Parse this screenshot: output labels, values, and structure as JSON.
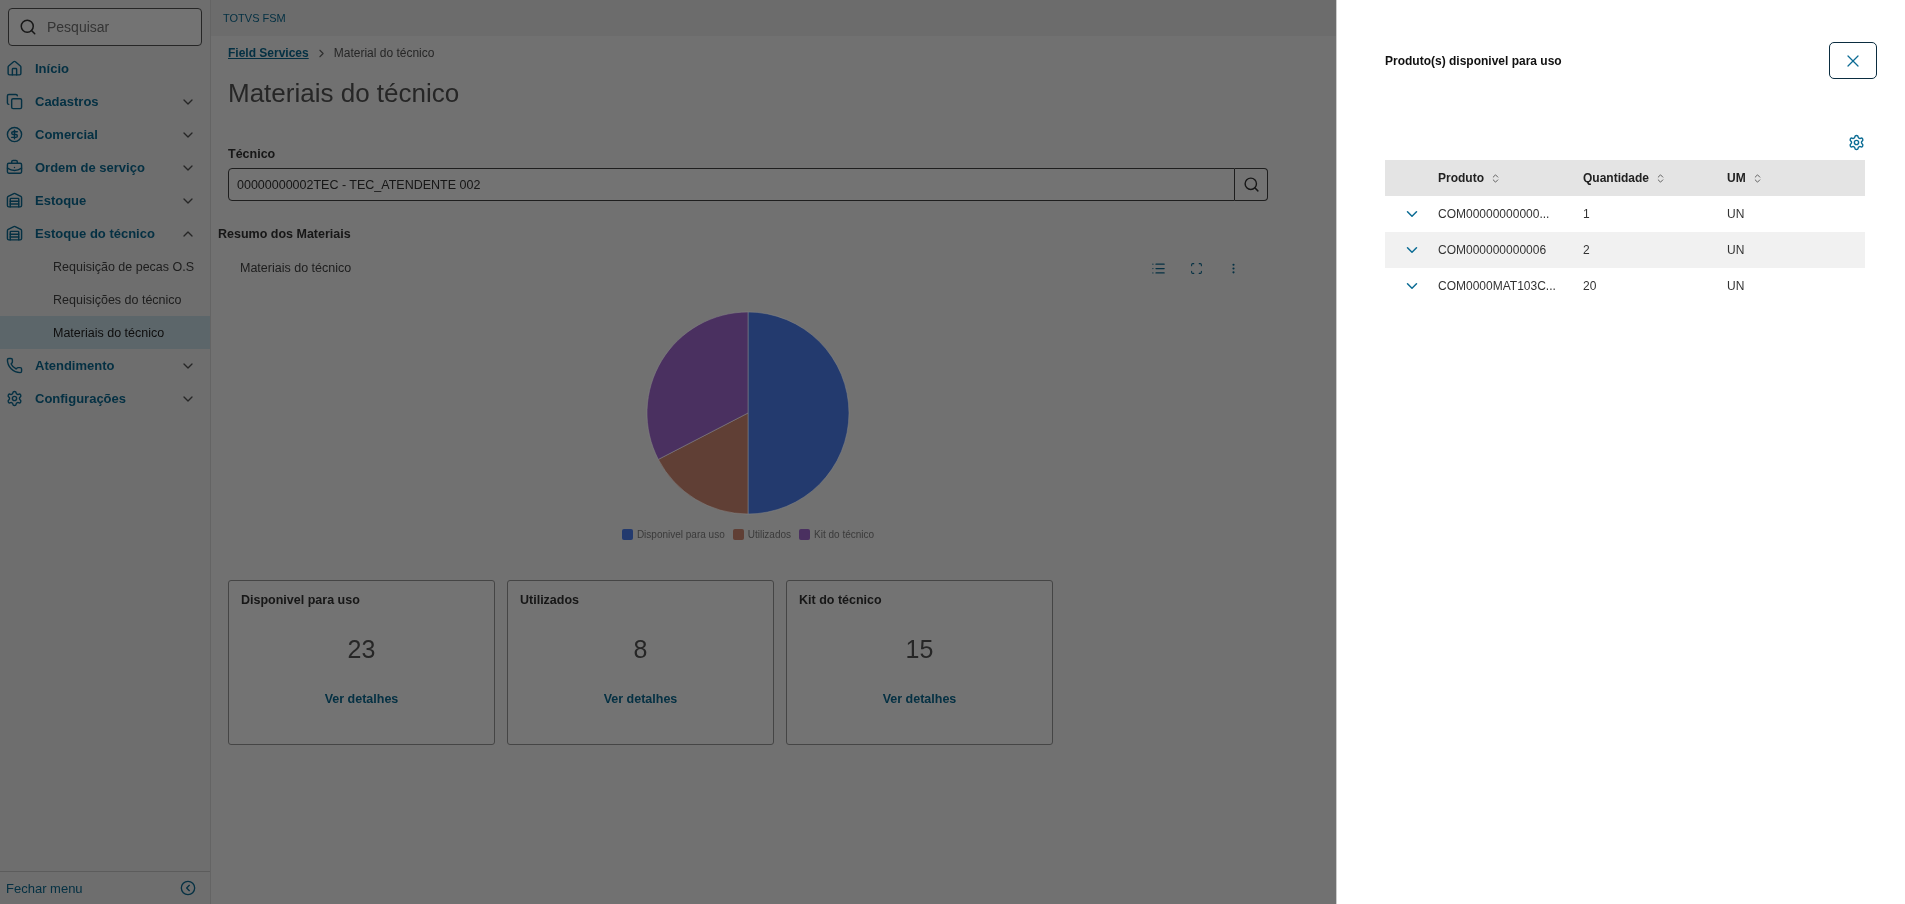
{
  "sidebar": {
    "search": {
      "placeholder": "Pesquisar"
    },
    "items": [
      {
        "label": "Início"
      },
      {
        "label": "Cadastros",
        "expanded": false
      },
      {
        "label": "Comercial",
        "expanded": false
      },
      {
        "label": "Ordem de serviço",
        "expanded": false
      },
      {
        "label": "Estoque",
        "expanded": false
      },
      {
        "label": "Estoque do técnico",
        "expanded": true,
        "children": [
          {
            "label": "Requisição de pecas O.S",
            "selected": false
          },
          {
            "label": "Requisições do técnico",
            "selected": false
          },
          {
            "label": "Materiais do técnico",
            "selected": true
          }
        ]
      },
      {
        "label": "Atendimento",
        "expanded": false
      },
      {
        "label": "Configurações",
        "expanded": false
      }
    ],
    "footer": "Fechar menu"
  },
  "header": {
    "title": "TOTVS FSM"
  },
  "breadcrumb": [
    "Field Services",
    "Material do técnico"
  ],
  "page_title": "Materiais do técnico",
  "tecnico_field": {
    "label": "Técnico",
    "value": "00000000002TEC - TEC_ATENDENTE 002"
  },
  "section_title": "Resumo dos Materiais",
  "chart": {
    "title": "Materiais do técnico",
    "chart_data": {
      "type": "pie",
      "categories": [
        "Disponivel para uso",
        "Utilizados",
        "Kit do técnico"
      ],
      "values": [
        50,
        17.4,
        32.6
      ]
    },
    "slices": [
      {
        "color": "#233a6e"
      },
      {
        "color": "#603f35"
      },
      {
        "color": "#4a3060"
      }
    ]
  },
  "cards": [
    {
      "title": "Disponivel para uso",
      "value": "23",
      "link": "Ver detalhes"
    },
    {
      "title": "Utilizados",
      "value": "8",
      "link": "Ver detalhes"
    },
    {
      "title": "Kit do técnico",
      "value": "15",
      "link": "Ver detalhes"
    }
  ],
  "drawer": {
    "title": "Produto(s) disponivel para uso",
    "table": {
      "columns": [
        "Produto",
        "Quantidade",
        "UM"
      ],
      "rows": [
        {
          "expanded": false,
          "cells": [
            "COM00000000000...",
            "1",
            "UN"
          ]
        },
        {
          "expanded": false,
          "cells": [
            "COM000000000006",
            "2",
            "UN"
          ]
        },
        {
          "expanded": false,
          "cells": [
            "COM0000MAT103C...",
            "20",
            "UN"
          ]
        }
      ]
    }
  }
}
